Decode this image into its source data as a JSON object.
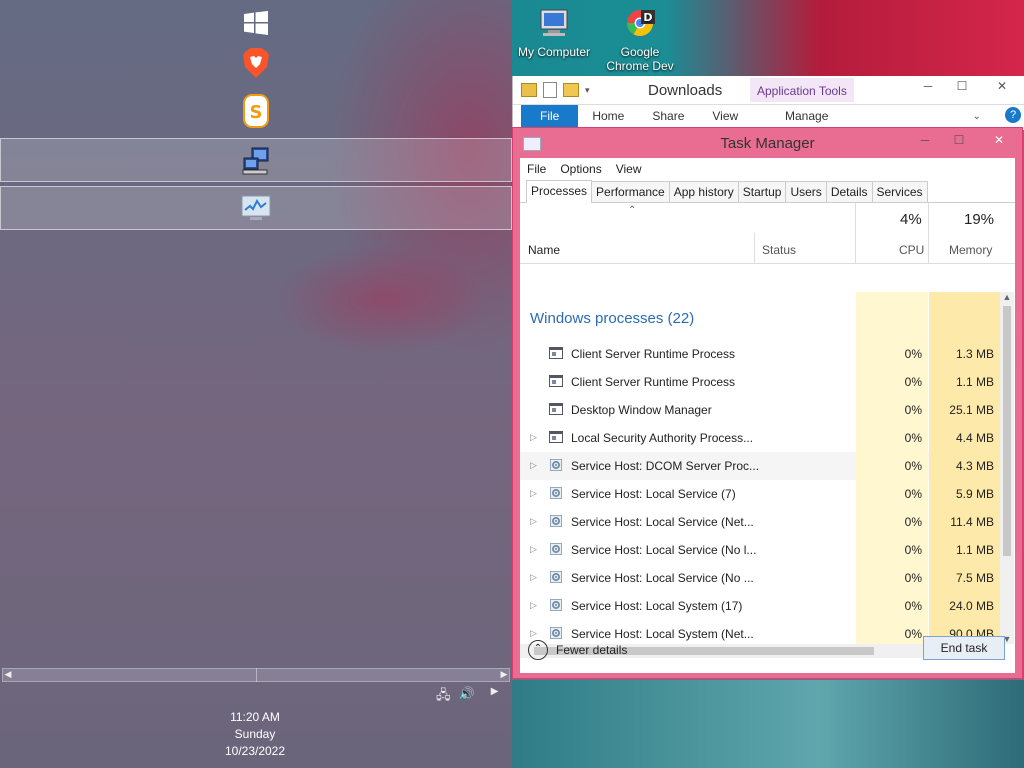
{
  "desktop": {
    "icons": [
      {
        "label_line1": "My Computer",
        "label_line2": "",
        "icon": "my-computer-icon"
      },
      {
        "label_line1": "Google",
        "label_line2": "Chrome Dev",
        "icon": "chrome-dev-icon"
      }
    ]
  },
  "appbar": {
    "items": [
      {
        "icon": "windows-logo-icon"
      },
      {
        "icon": "brave-browser-icon"
      },
      {
        "icon": "sublime-text-icon"
      },
      {
        "icon": "network-computer-icon"
      },
      {
        "icon": "task-manager-app-icon"
      }
    ]
  },
  "clock": {
    "time": "11:20 AM",
    "day": "Sunday",
    "date": "10/23/2022"
  },
  "explorer": {
    "title": "Downloads",
    "context_tab": "Application Tools",
    "ribbon": {
      "file": "File",
      "home": "Home",
      "share": "Share",
      "view": "View",
      "manage": "Manage"
    }
  },
  "taskmanager": {
    "title": "Task Manager",
    "menu": {
      "file": "File",
      "options": "Options",
      "view": "View"
    },
    "tabs": [
      "Processes",
      "Performance",
      "App history",
      "Startup",
      "Users",
      "Details",
      "Services"
    ],
    "columns": {
      "name": "Name",
      "status": "Status",
      "cpu_pct": "4%",
      "cpu": "CPU",
      "mem_pct": "19%",
      "mem": "Memory"
    },
    "group": "Windows processes (22)",
    "rows": [
      {
        "name": "Client Server Runtime Process",
        "cpu": "0%",
        "mem": "1.3 MB",
        "expandable": false,
        "icon": "app-window-icon"
      },
      {
        "name": "Client Server Runtime Process",
        "cpu": "0%",
        "mem": "1.1 MB",
        "expandable": false,
        "icon": "app-window-icon"
      },
      {
        "name": "Desktop Window Manager",
        "cpu": "0%",
        "mem": "25.1 MB",
        "expandable": false,
        "icon": "app-window-icon"
      },
      {
        "name": "Local Security Authority Process...",
        "cpu": "0%",
        "mem": "4.4 MB",
        "expandable": true,
        "icon": "app-window-icon"
      },
      {
        "name": "Service Host: DCOM Server Proc...",
        "cpu": "0%",
        "mem": "4.3 MB",
        "expandable": true,
        "icon": "gear-icon"
      },
      {
        "name": "Service Host: Local Service (7)",
        "cpu": "0%",
        "mem": "5.9 MB",
        "expandable": true,
        "icon": "gear-icon"
      },
      {
        "name": "Service Host: Local Service (Net...",
        "cpu": "0%",
        "mem": "11.4 MB",
        "expandable": true,
        "icon": "gear-icon"
      },
      {
        "name": "Service Host: Local Service (No l...",
        "cpu": "0%",
        "mem": "1.1 MB",
        "expandable": true,
        "icon": "gear-icon"
      },
      {
        "name": "Service Host: Local Service (No ...",
        "cpu": "0%",
        "mem": "7.5 MB",
        "expandable": true,
        "icon": "gear-icon"
      },
      {
        "name": "Service Host: Local System (17)",
        "cpu": "0%",
        "mem": "24.0 MB",
        "expandable": true,
        "icon": "gear-icon"
      },
      {
        "name": "Service Host: Local System (Net...",
        "cpu": "0%",
        "mem": "90.0 MB",
        "expandable": true,
        "icon": "gear-icon"
      }
    ],
    "fewer_details": "Fewer details",
    "end_task": "End task"
  }
}
